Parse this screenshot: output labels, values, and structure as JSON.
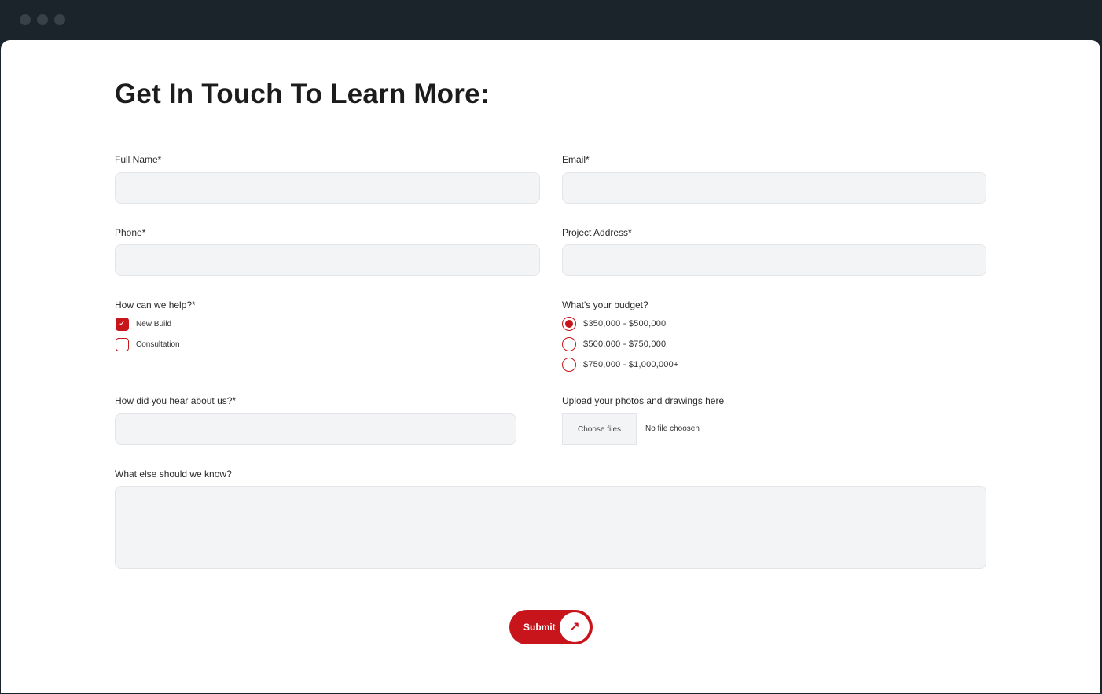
{
  "window": {
    "dots": [
      "window-dot",
      "window-dot",
      "window-dot"
    ]
  },
  "form": {
    "title": "Get In Touch To Learn More:",
    "full_name_label": "Full Name*",
    "email_label": "Email*",
    "phone_label": "Phone*",
    "project_address_label": "Project Address*",
    "help_label": "How can we help?*",
    "help_options": [
      {
        "label": "New Build",
        "checked": true
      },
      {
        "label": "Consultation",
        "checked": false
      }
    ],
    "budget_label": "What's your budget?",
    "budget_options": [
      {
        "label": "$350,000 - $500,000",
        "selected": true
      },
      {
        "label": "$500,000 - $750,000",
        "selected": false
      },
      {
        "label": "$750,000 - $1,000,000+",
        "selected": false
      }
    ],
    "hear_label": "How did you hear about us?*",
    "upload_label": "Upload your photos and drawings here",
    "choose_files": "Choose files",
    "no_file": "No file choosen",
    "know_label": "What else should we know?",
    "submit_label": "Submit",
    "submit_icon": "arrow-up-right-icon"
  },
  "colors": {
    "accent": "#c8141b",
    "field_bg": "#f3f4f6",
    "frame": "#1b232b"
  }
}
